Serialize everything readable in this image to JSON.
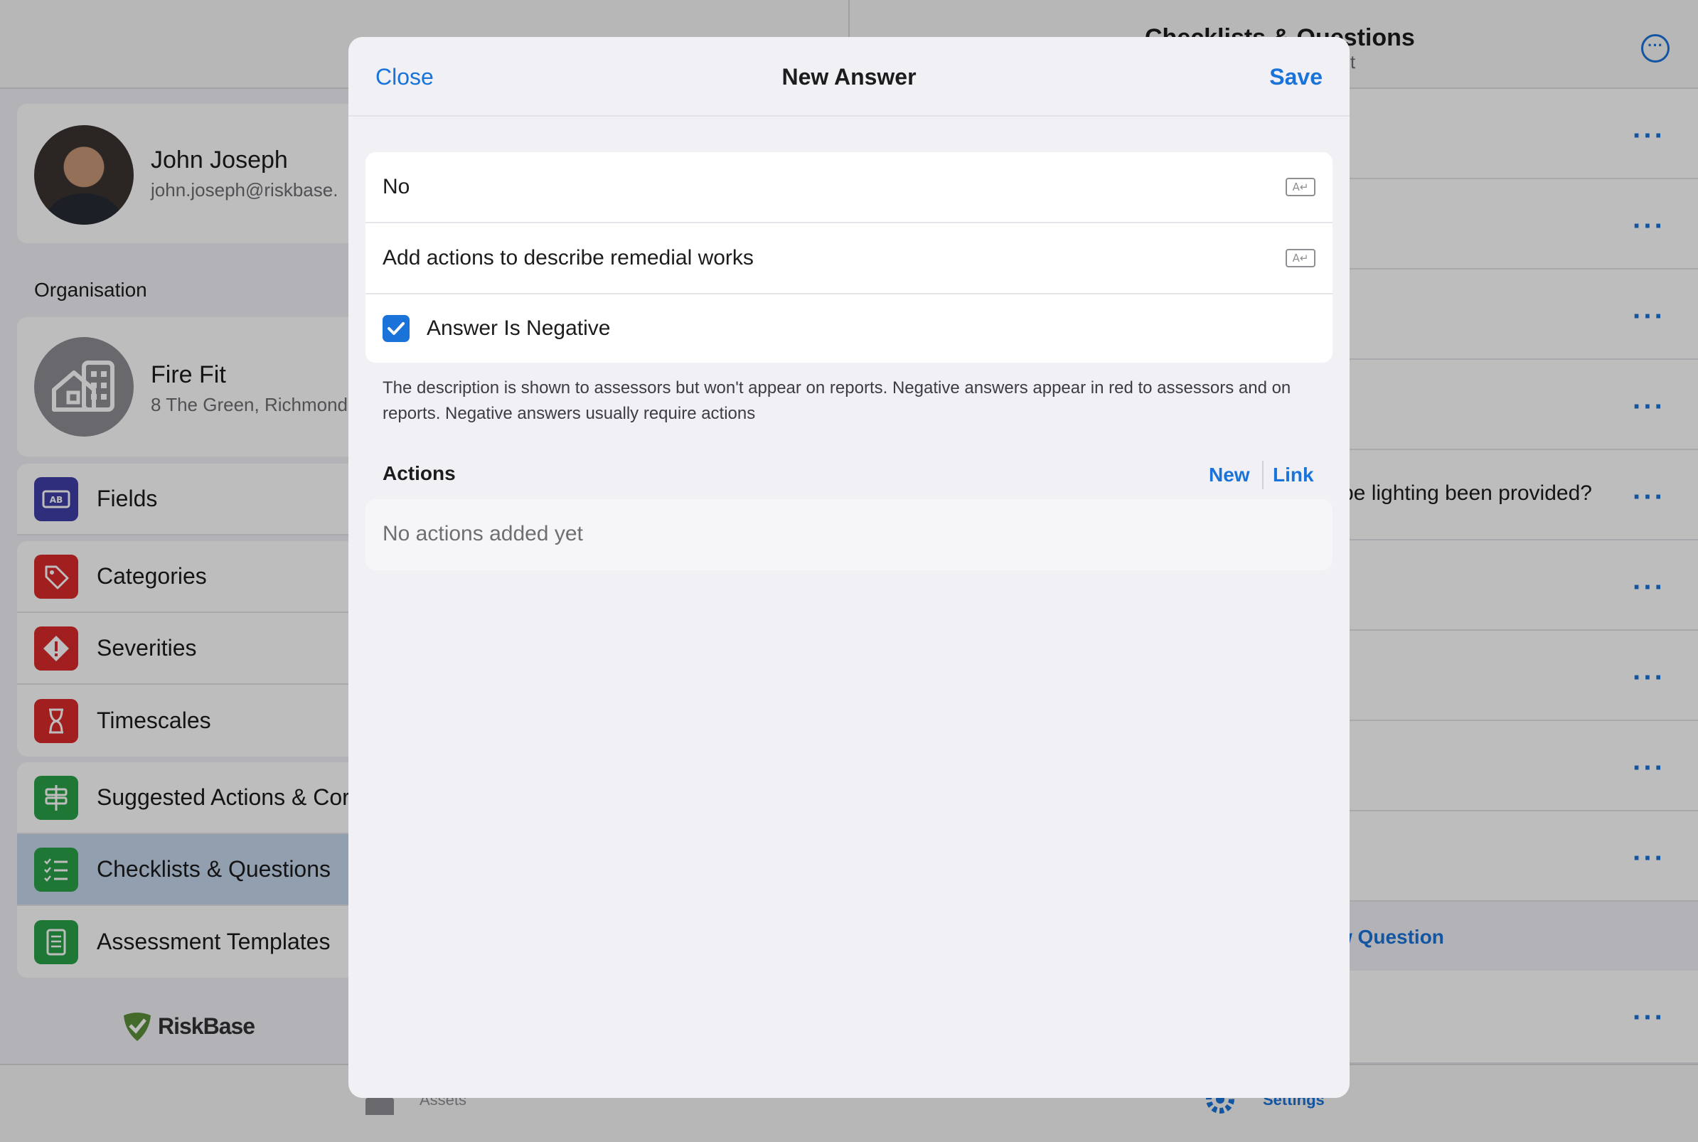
{
  "background": {
    "profile": {
      "name": "John Joseph",
      "email": "john.joseph@riskbase."
    },
    "organisation": {
      "heading": "Organisation",
      "name": "Fire Fit",
      "address": "8 The Green, Richmond"
    },
    "menu": [
      {
        "label": "Fields",
        "icon": "ab-field-icon",
        "color": "#3f3fa8"
      },
      {
        "label": "Categories",
        "icon": "tag-icon",
        "color": "#d92b2b"
      },
      {
        "label": "Severities",
        "icon": "warning-diamond-icon",
        "color": "#d92b2b"
      },
      {
        "label": "Timescales",
        "icon": "hourglass-icon",
        "color": "#d92b2b"
      },
      {
        "label": "Suggested Actions & Cor",
        "icon": "signpost-icon",
        "color": "#2aa14a"
      },
      {
        "label": "Checklists & Questions",
        "icon": "checklist-icon",
        "color": "#2aa14a",
        "selected": true
      },
      {
        "label": "Assessment Templates",
        "icon": "template-list-icon",
        "color": "#2aa14a"
      }
    ],
    "brand": "RiskBase",
    "right_pane": {
      "title": "Checklists & Questions",
      "subtitle": "ent",
      "row_text": "be lighting been provided?",
      "new_question": "w Question",
      "more_dots": "···"
    },
    "tabs": {
      "assets": "Assets",
      "settings": "Settings"
    }
  },
  "modal": {
    "close_label": "Close",
    "title": "New Answer",
    "save_label": "Save",
    "answer_value": "No",
    "description_value": "Add actions to describe remedial works",
    "negative_label": "Answer Is Negative",
    "negative_checked": true,
    "footnote": "The description is shown to assessors but won't appear on reports. Negative answers appear in red to assessors and on reports. Negative answers usually require actions",
    "actions": {
      "heading": "Actions",
      "new_label": "New",
      "link_label": "Link",
      "empty_text": "No actions added yet"
    }
  },
  "colors": {
    "accent": "#1a73d9",
    "green": "#2aa14a",
    "red": "#d92b2b",
    "indigo": "#3f3fa8"
  }
}
